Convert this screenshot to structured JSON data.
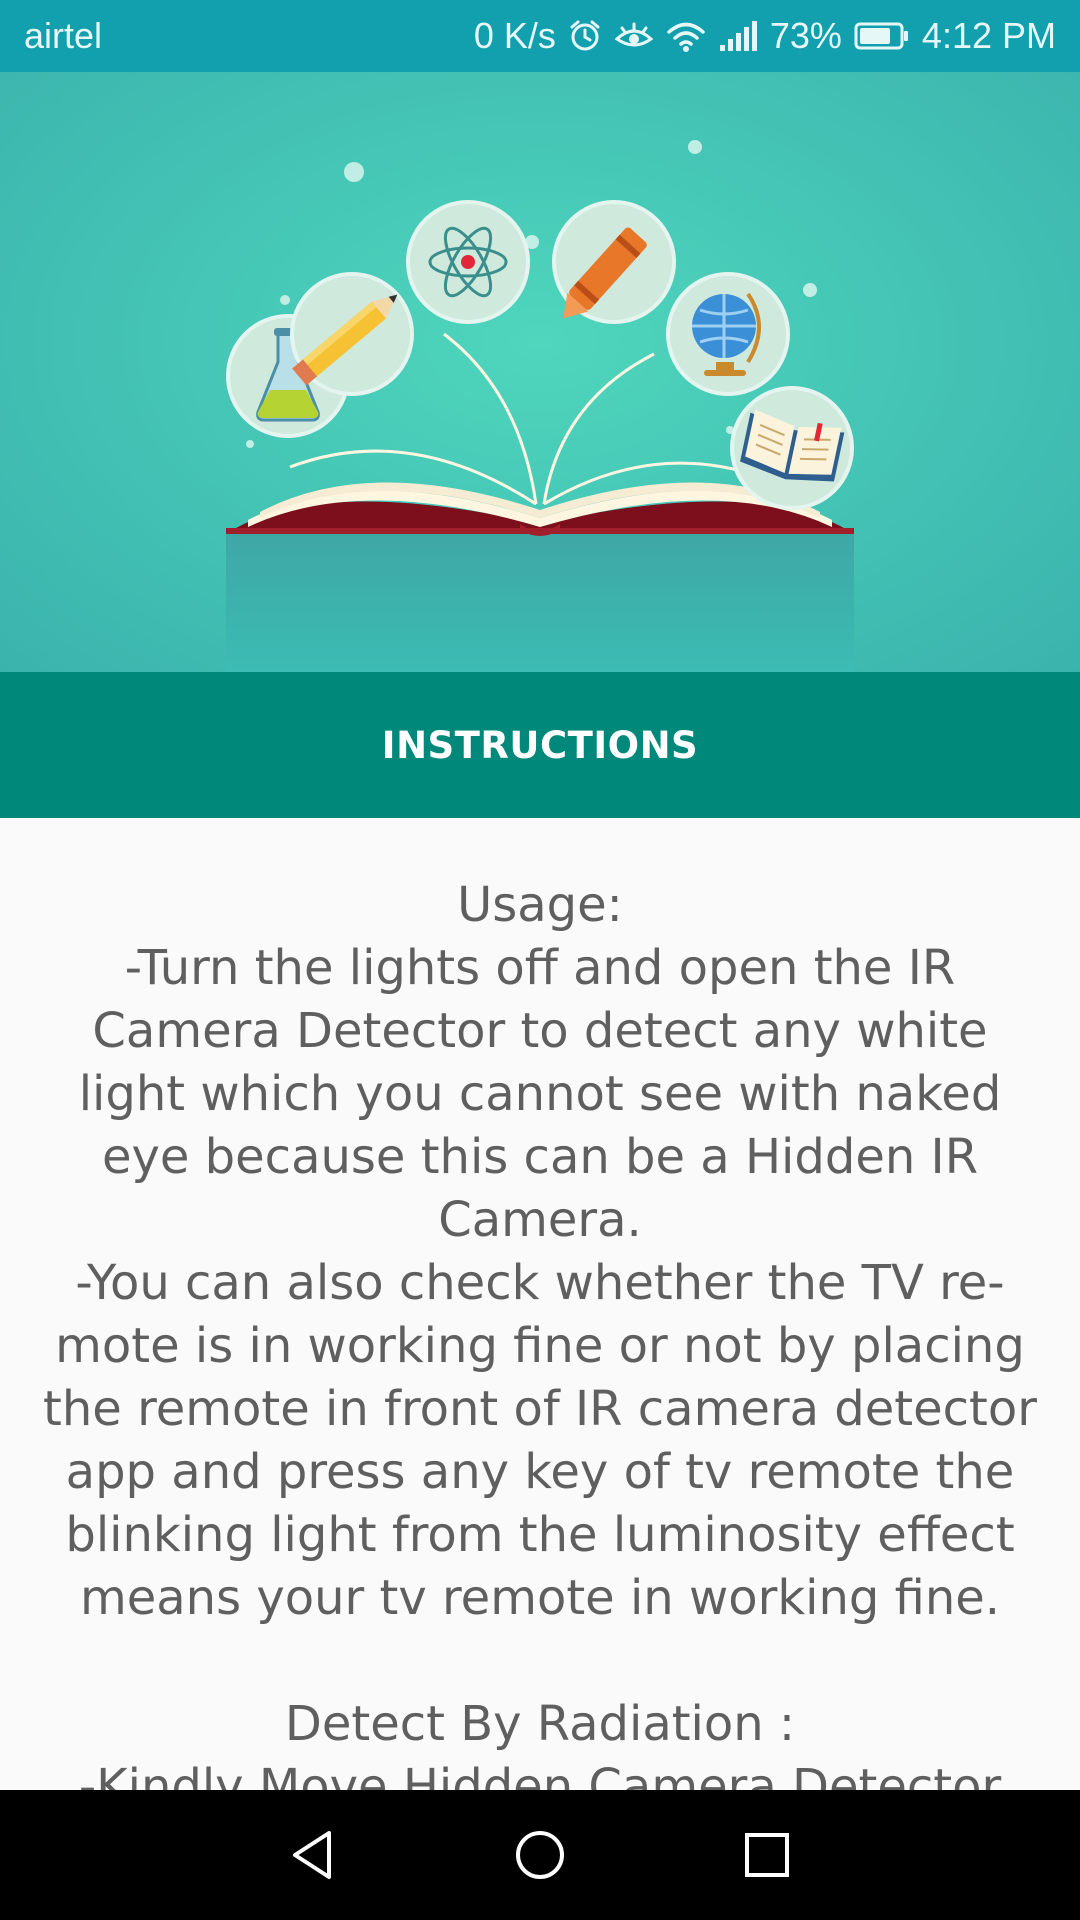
{
  "status_bar": {
    "carrier": "airtel",
    "net_speed": "0 K/s",
    "battery": "73%",
    "time": "4:12 PM",
    "icons": [
      "alarm-icon",
      "eye-comfort-icon",
      "wifi-icon",
      "signal-icon",
      "battery-icon"
    ]
  },
  "hero": {
    "illustration": "open-book-with-science-icons",
    "icons": [
      "flask-icon",
      "pencil-icon",
      "atom-icon",
      "crayon-icon",
      "globe-icon",
      "book-icon"
    ]
  },
  "banner": {
    "title": "INSTRUCTIONS"
  },
  "content": {
    "text": "Usage:\n-Turn the lights off and open the IR Camera Detector to detect any white light which you cannot see with naked eye because this can be a Hidden IR Camera.\n-You can also check whether the TV re-mote is in working fine or not by placing the remote in front of IR camera detector app and press any key of tv remote the blinking light from the luminosity effect means your tv remote in working fine.\n\nDetect By Radiation :\n-Kindly Move Hidden Camera Detector"
  },
  "nav_bar": {
    "buttons": [
      "back-icon",
      "home-icon",
      "recents-icon"
    ]
  },
  "colors": {
    "status_bar": "#129fae",
    "hero_background": "#45c6b6",
    "banner": "#00887a",
    "body_text": "#5f5f5f",
    "nav_bar": "#000000"
  }
}
